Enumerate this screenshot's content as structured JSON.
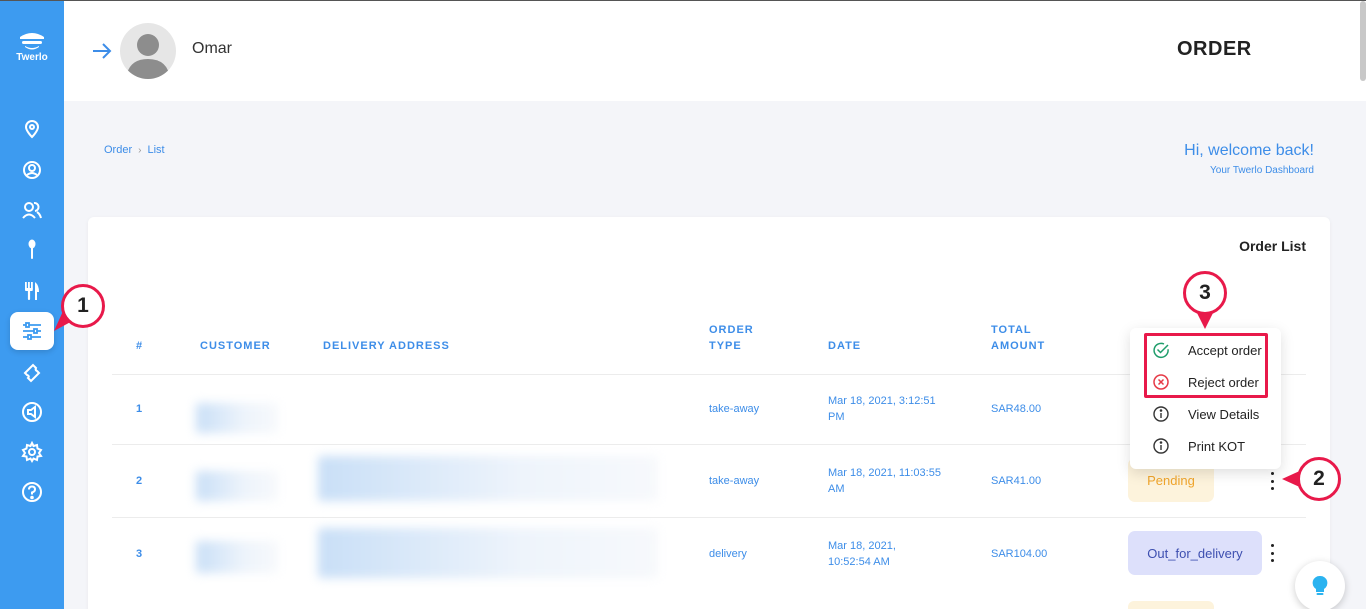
{
  "brand": {
    "name": "Twerlo"
  },
  "sidebar": {
    "items": [
      {
        "name": "location",
        "icon": "map-pin-icon"
      },
      {
        "name": "profile",
        "icon": "user-circle-icon"
      },
      {
        "name": "users",
        "icon": "users-icon"
      },
      {
        "name": "spoon",
        "icon": "spoon-icon"
      },
      {
        "name": "menu",
        "icon": "fork-knife-icon"
      },
      {
        "name": "orders",
        "icon": "sliders-icon",
        "active": true
      },
      {
        "name": "tickets",
        "icon": "ticket-icon"
      },
      {
        "name": "broadcast",
        "icon": "megaphone-icon"
      },
      {
        "name": "settings",
        "icon": "gear-icon"
      },
      {
        "name": "help",
        "icon": "help-icon"
      }
    ]
  },
  "header": {
    "username": "Omar",
    "title": "ORDER"
  },
  "breadcrumb": {
    "root": "Order",
    "current": "List"
  },
  "welcome": {
    "title": "Hi, welcome back!",
    "subtitle": "Your Twerlo Dashboard"
  },
  "card": {
    "title": "Order List",
    "columns": {
      "index": "#",
      "customer": "CUSTOMER",
      "address": "DELIVERY ADDRESS",
      "order_type_line1": "ORDER",
      "order_type_line2": "TYPE",
      "date": "DATE",
      "total_line1": "TOTAL",
      "total_line2": "AMOUNT"
    },
    "rows": [
      {
        "index": "1",
        "type": "take-away",
        "date_line1": "Mar 18, 2021, 3:12:51",
        "date_line2": "PM",
        "total": "SAR48.00",
        "status": ""
      },
      {
        "index": "2",
        "type": "take-away",
        "date_line1": "Mar 18, 2021, 11:03:55",
        "date_line2": "AM",
        "total": "SAR41.00",
        "status": "Pending"
      },
      {
        "index": "3",
        "type": "delivery",
        "date_line1": "Mar 18, 2021,",
        "date_line2": "10:52:54 AM",
        "total": "SAR104.00",
        "status": "Out_for_delivery"
      }
    ]
  },
  "menu": {
    "items": [
      {
        "label": "Accept order",
        "icon": "check-circle-icon"
      },
      {
        "label": "Reject order",
        "icon": "x-circle-icon"
      },
      {
        "label": "View Details",
        "icon": "info-icon"
      },
      {
        "label": "Print KOT",
        "icon": "info-icon"
      }
    ]
  },
  "callouts": {
    "one": "1",
    "two": "2",
    "three": "3"
  },
  "colors": {
    "sidebar": "#3d9bf0",
    "accent": "#3d8de8",
    "callout": "#e8194a",
    "pending": "#f0a52c"
  }
}
